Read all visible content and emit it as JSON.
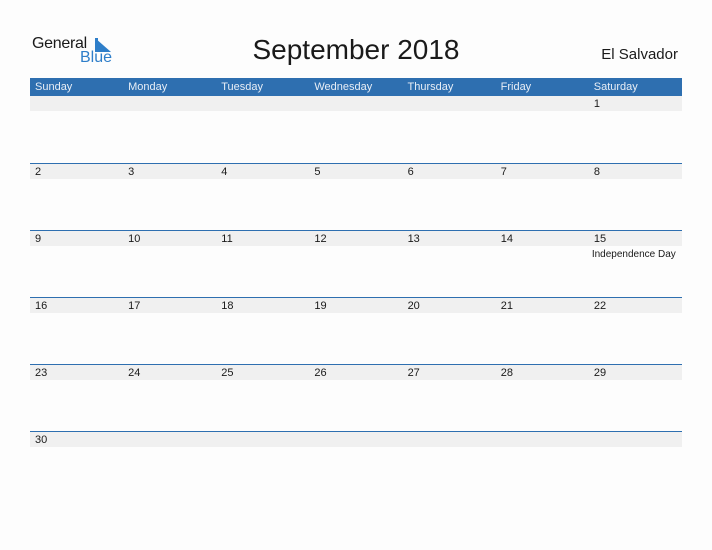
{
  "logo": {
    "general": "General",
    "blue": "Blue"
  },
  "title": "September 2018",
  "country": "El Salvador",
  "colors": {
    "header": "#2e6fb0",
    "accent": "#2e7ec9",
    "strip": "#f0f0f0"
  },
  "weekdays": [
    "Sunday",
    "Monday",
    "Tuesday",
    "Wednesday",
    "Thursday",
    "Friday",
    "Saturday"
  ],
  "weeks": [
    [
      "",
      "",
      "",
      "",
      "",
      "",
      "1"
    ],
    [
      "2",
      "3",
      "4",
      "5",
      "6",
      "7",
      "8"
    ],
    [
      "9",
      "10",
      "11",
      "12",
      "13",
      "14",
      "15"
    ],
    [
      "16",
      "17",
      "18",
      "19",
      "20",
      "21",
      "22"
    ],
    [
      "23",
      "24",
      "25",
      "26",
      "27",
      "28",
      "29"
    ],
    [
      "30",
      "",
      "",
      "",
      "",
      "",
      ""
    ]
  ],
  "events": [
    {
      "week": 2,
      "day": 6,
      "label": "Independence Day"
    }
  ]
}
